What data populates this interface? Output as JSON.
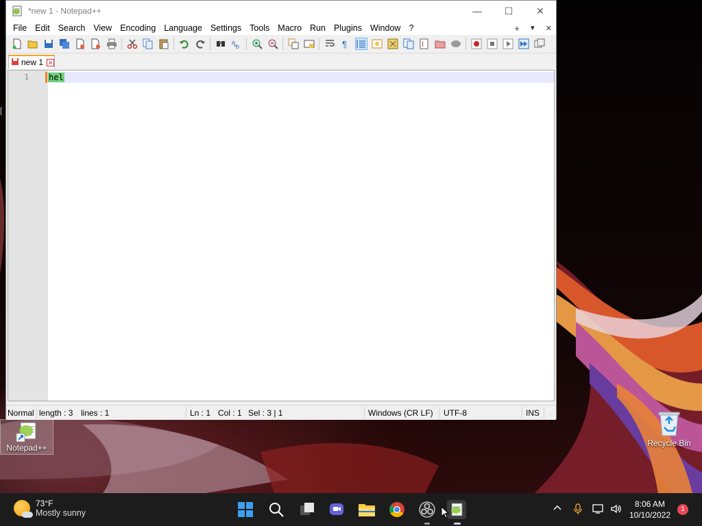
{
  "window": {
    "title": "*new 1 - Notepad++",
    "controls": {
      "minimize": "—",
      "maximize": "☐",
      "close": "✕"
    }
  },
  "menu": {
    "items": [
      "File",
      "Edit",
      "Search",
      "View",
      "Encoding",
      "Language",
      "Settings",
      "Tools",
      "Macro",
      "Run",
      "Plugins",
      "Window",
      "?"
    ],
    "right": {
      "add": "+",
      "dropdown": "▼",
      "close": "✕"
    }
  },
  "tab": {
    "label": "new 1",
    "close": "✕"
  },
  "editor": {
    "line_number": "1",
    "text": "hel"
  },
  "status": {
    "mode": "Normal",
    "length": "length : 3",
    "lines": "lines : 1",
    "ln": "Ln : 1",
    "col": "Col : 1",
    "sel": "Sel : 3 | 1",
    "eol": "Windows (CR LF)",
    "encoding": "UTF-8",
    "ins": "INS"
  },
  "desktop": {
    "notepad_label": "Notepad++",
    "recycle_label": "Recycle Bin"
  },
  "taskbar": {
    "weather_temp": "73°F",
    "weather_desc": "Mostly sunny",
    "time": "8:06 AM",
    "date": "10/10/2022",
    "notification_count": "1"
  },
  "colors": {
    "selection": "#6fd17a",
    "caret": "#f58220",
    "current_line": "#e8e8ff",
    "taskbar": "#1c1c1c"
  }
}
